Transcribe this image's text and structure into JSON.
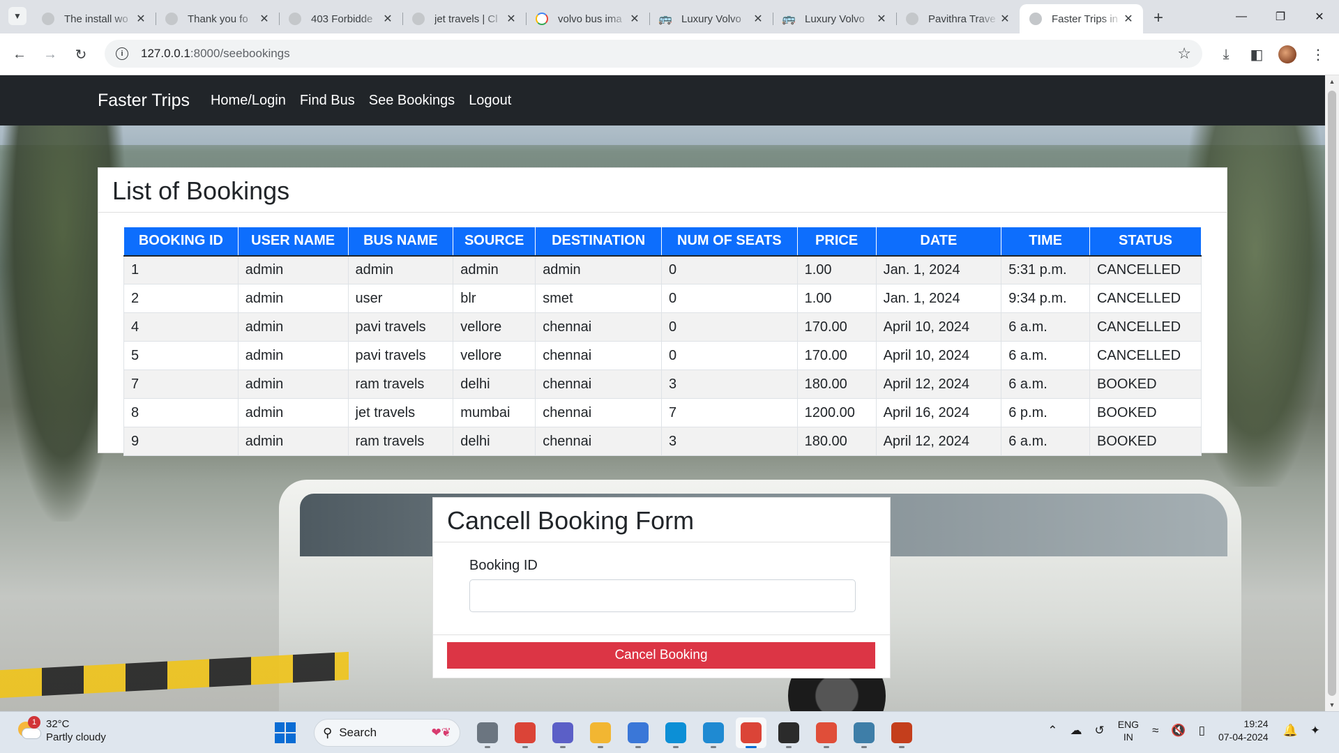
{
  "browser": {
    "tabs": [
      {
        "title": "The install wo",
        "icon": "generic-favicon",
        "active": false
      },
      {
        "title": "Thank you fo",
        "icon": "generic-favicon",
        "active": false
      },
      {
        "title": "403 Forbidde",
        "icon": "generic-favicon",
        "active": false
      },
      {
        "title": "jet travels | Cl",
        "icon": "generic-favicon",
        "active": false
      },
      {
        "title": "volvo bus ima",
        "icon": "google-icon",
        "active": false
      },
      {
        "title": "Luxury Volvo",
        "icon": "car-icon",
        "active": false
      },
      {
        "title": "Luxury Volvo",
        "icon": "car-icon",
        "active": false
      },
      {
        "title": "Pavithra Trave",
        "icon": "generic-favicon",
        "active": false
      },
      {
        "title": "Faster Trips in",
        "icon": "generic-favicon",
        "active": true
      }
    ],
    "url_host": "127.0.0.1",
    "url_path": ":8000/seebookings"
  },
  "navbar": {
    "brand": "Faster Trips",
    "links": [
      "Home/Login",
      "Find Bus",
      "See Bookings",
      "Logout"
    ]
  },
  "bookings": {
    "title": "List of Bookings",
    "headers": [
      "BOOKING ID",
      "USER NAME",
      "BUS NAME",
      "SOURCE",
      "DESTINATION",
      "NUM OF SEATS",
      "PRICE",
      "DATE",
      "TIME",
      "STATUS"
    ],
    "rows": [
      [
        "1",
        "admin",
        "admin",
        "admin",
        "admin",
        "0",
        "1.00",
        "Jan. 1, 2024",
        "5:31 p.m.",
        "CANCELLED"
      ],
      [
        "2",
        "admin",
        "user",
        "blr",
        "smet",
        "0",
        "1.00",
        "Jan. 1, 2024",
        "9:34 p.m.",
        "CANCELLED"
      ],
      [
        "4",
        "admin",
        "pavi travels",
        "vellore",
        "chennai",
        "0",
        "170.00",
        "April 10, 2024",
        "6 a.m.",
        "CANCELLED"
      ],
      [
        "5",
        "admin",
        "pavi travels",
        "vellore",
        "chennai",
        "0",
        "170.00",
        "April 10, 2024",
        "6 a.m.",
        "CANCELLED"
      ],
      [
        "7",
        "admin",
        "ram travels",
        "delhi",
        "chennai",
        "3",
        "180.00",
        "April 12, 2024",
        "6 a.m.",
        "BOOKED"
      ],
      [
        "8",
        "admin",
        "jet travels",
        "mumbai",
        "chennai",
        "7",
        "1200.00",
        "April 16, 2024",
        "6 p.m.",
        "BOOKED"
      ],
      [
        "9",
        "admin",
        "ram travels",
        "delhi",
        "chennai",
        "3",
        "180.00",
        "April 12, 2024",
        "6 a.m.",
        "BOOKED"
      ]
    ]
  },
  "cancel_form": {
    "title": "Cancell Booking Form",
    "label": "Booking ID",
    "value": "",
    "button": "Cancel Booking"
  },
  "colors": {
    "navbar": "#212529",
    "table_header": "#0d6efd",
    "danger": "#dc3545"
  },
  "taskbar": {
    "weather_temp": "32°C",
    "weather_desc": "Partly cloudy",
    "weather_badge": "1",
    "search_label": "Search",
    "apps": [
      {
        "name": "file-viewer-icon",
        "color": "#6b7580",
        "active": false
      },
      {
        "name": "chrome-icon",
        "color": "#db4437",
        "active": false
      },
      {
        "name": "teams-icon",
        "color": "#5b5fc7",
        "active": false
      },
      {
        "name": "file-explorer-icon",
        "color": "#f2b632",
        "active": false
      },
      {
        "name": "store-icon",
        "color": "#3a77d8",
        "active": false
      },
      {
        "name": "edge-icon",
        "color": "#0c8fd6",
        "active": false
      },
      {
        "name": "vscode-icon",
        "color": "#1f8ad2",
        "active": false
      },
      {
        "name": "chrome-active-icon",
        "color": "#db4437",
        "active": true
      },
      {
        "name": "terminal-icon",
        "color": "#2b2b2b",
        "active": false
      },
      {
        "name": "git-icon",
        "color": "#e04e39",
        "active": false
      },
      {
        "name": "mysql-icon",
        "color": "#3e7ea8",
        "active": false
      },
      {
        "name": "powerpoint-icon",
        "color": "#c43e1c",
        "active": false
      }
    ],
    "lang_top": "ENG",
    "lang_bottom": "IN",
    "time": "19:24",
    "date": "07-04-2024"
  }
}
